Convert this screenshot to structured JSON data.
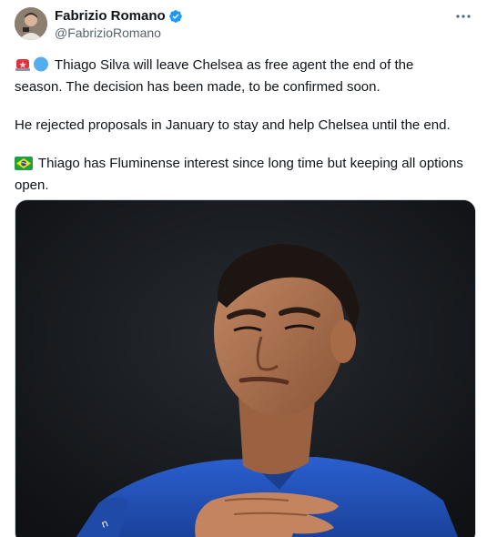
{
  "author": {
    "display_name": "Fabrizio Romano",
    "handle": "@FabrizioRomano",
    "verified": true
  },
  "icons": {
    "verified": "verified-badge-icon",
    "more": "more-options-icon",
    "siren": "police-siren-emoji-icon",
    "blue_circle": "blue-circle-emoji-icon",
    "brazil_flag": "brazil-flag-emoji-icon"
  },
  "tweet": {
    "line1": "Thiago Silva will leave Chelsea as free agent the end of the season. The decision has been made, to be confirmed soon.",
    "line2": "He rejected proposals in January to stay and help Chelsea until the end.",
    "line3": "Thiago has Fluminense interest since long time but keeping all options open."
  },
  "colors": {
    "verified": "#1d9bf0",
    "text": "#0f1419",
    "secondary": "#536471",
    "kit_blue": "#1f4fb5"
  }
}
